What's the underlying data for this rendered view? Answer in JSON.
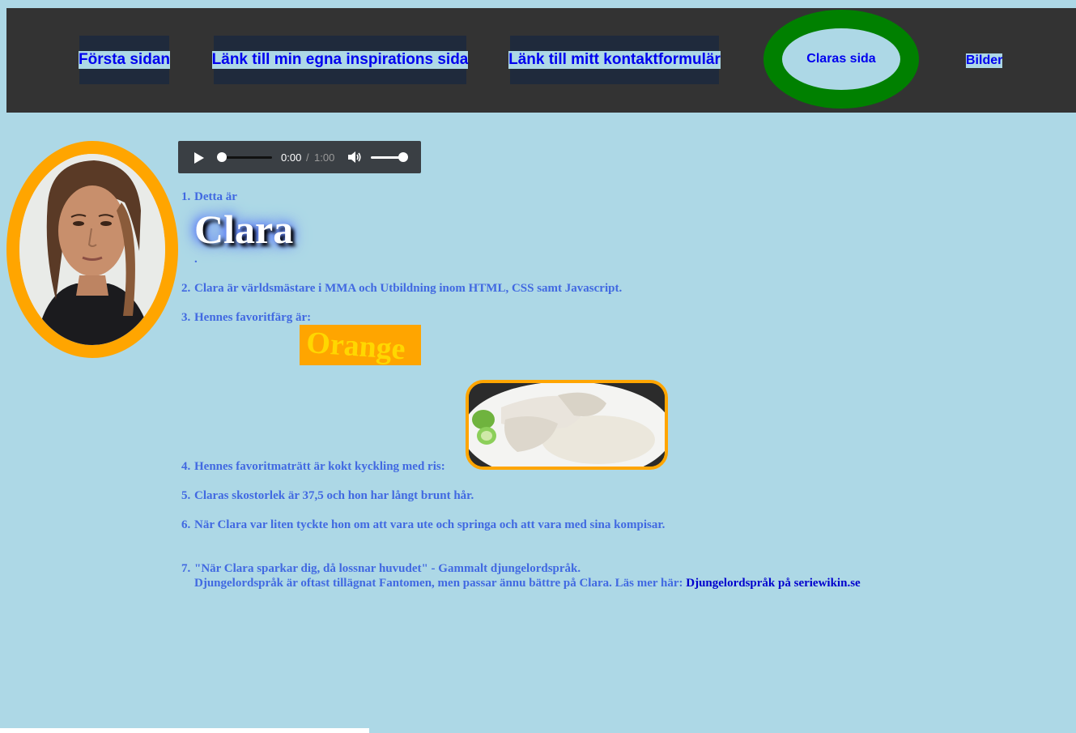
{
  "nav": {
    "items": [
      {
        "label": "Första sidan"
      },
      {
        "label": "Länk till min egna inspirations sida"
      },
      {
        "label": "Länk till mitt kontaktformulär"
      },
      {
        "label": "Claras sida"
      },
      {
        "label": "Bilder"
      }
    ]
  },
  "audio": {
    "current_time": "0:00",
    "separator": "/",
    "total_time": "1:00"
  },
  "content": {
    "items": [
      {
        "num": "1.",
        "text": "Detta är"
      },
      {
        "num": "2.",
        "text": "Clara är världsmästare i MMA och Utbildning inom HTML, CSS samt Javascript."
      },
      {
        "num": "3.",
        "text": "Hennes favoritfärg är:"
      },
      {
        "num": "4.",
        "text": "Hennes favoritmaträtt är kokt kyckling med ris:"
      },
      {
        "num": "5.",
        "text": "Claras skostorlek är 37,5 och hon har långt brunt hår."
      },
      {
        "num": "6.",
        "text": "När Clara var liten tyckte hon om att vara ute och springa och att vara med sina kompisar."
      },
      {
        "num": "7.",
        "text": "\"När Clara sparkar dig, då lossnar huvudet\" - Gammalt djungelordspråk."
      }
    ],
    "name_big": "Clara",
    "name_dot": ".",
    "favorite_color_word": "Orange",
    "item7_line2": "Djungelordspråk är oftast tillägnat Fantomen, men passar ännu bättre på Clara. Läs mer här:",
    "wiki_link": "Djungelordspråk på seriewikin.se"
  },
  "colors": {
    "background": "#add8e6",
    "nav_bg": "#333333",
    "accent_orange": "#ffa500",
    "accent_green": "#008000",
    "list_text": "#4169e1",
    "link": "#0000ee"
  },
  "icons": [
    "play-icon",
    "volume-icon"
  ]
}
